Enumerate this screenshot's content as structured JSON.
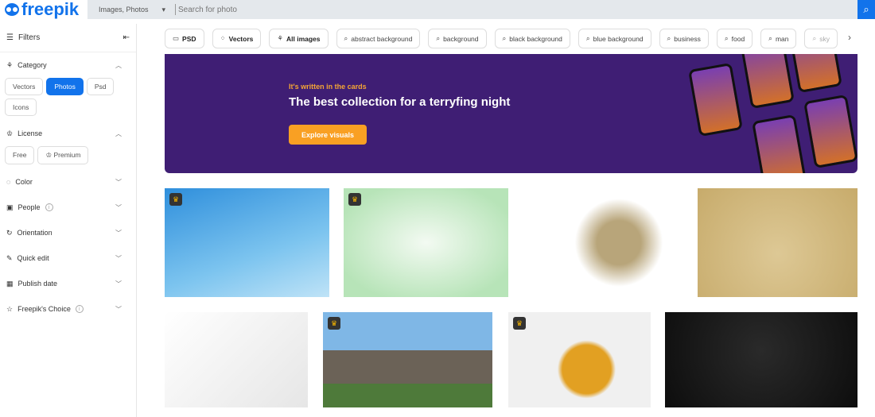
{
  "header": {
    "logo": "freepik",
    "search_type": "Images, Photos",
    "search_placeholder": "Search for photo"
  },
  "sidebar": {
    "filters_label": "Filters",
    "category": {
      "label": "Category",
      "options": [
        "Vectors",
        "Photos",
        "Psd",
        "Icons"
      ],
      "selected": "Photos"
    },
    "license": {
      "label": "License",
      "options": [
        "Free",
        "Premium"
      ]
    },
    "sections": [
      {
        "label": "Color",
        "icon": "palette-icon"
      },
      {
        "label": "People",
        "icon": "person-icon",
        "info": true
      },
      {
        "label": "Orientation",
        "icon": "rotate-icon"
      },
      {
        "label": "Quick edit",
        "icon": "brush-icon"
      },
      {
        "label": "Publish date",
        "icon": "calendar-icon"
      },
      {
        "label": "Freepik's Choice",
        "icon": "star-icon",
        "info": true
      }
    ]
  },
  "tags": {
    "types": [
      "PSD",
      "Vectors",
      "All images"
    ],
    "searches": [
      "abstract background",
      "background",
      "black background",
      "blue background",
      "business",
      "food",
      "man",
      "sky"
    ]
  },
  "banner": {
    "kicker": "It's written in the cards",
    "title": "The best collection for a terryfing night",
    "button": "Explore visuals"
  },
  "colors": {
    "brand": "#1273eb",
    "banner": "#3f1e74",
    "cta": "#f9a023",
    "kicker": "#f4a535"
  },
  "images": [
    {
      "name": "blue-sky",
      "premium": true
    },
    {
      "name": "green-gradient",
      "premium": true
    },
    {
      "name": "v6-logo-white",
      "premium": false
    },
    {
      "name": "v6-logo-gold",
      "premium": false
    },
    {
      "name": "white-halftone",
      "premium": false
    },
    {
      "name": "modern-house",
      "premium": true
    },
    {
      "name": "graduate-woman",
      "premium": true
    },
    {
      "name": "black-texture",
      "premium": false
    }
  ]
}
